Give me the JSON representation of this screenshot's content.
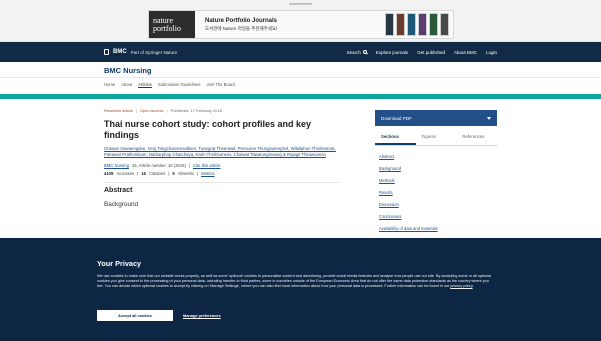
{
  "ad": {
    "label": "Advertisement",
    "logo_line1": "nature",
    "logo_line2": "portfolio",
    "title": "Nature Portfolio Journals",
    "subtitle": "도서관에 Nature 저널을 추천해주세요!"
  },
  "topbar": {
    "brand": "BMC",
    "part": "Part of Springer Nature",
    "search": "Search",
    "nav": [
      "Explore journals",
      "Get published",
      "About BMC",
      "Login"
    ]
  },
  "journal": {
    "title": "BMC Nursing"
  },
  "breadcrumbs": [
    "Home",
    "About",
    "Articles",
    "Submission Guidelines",
    "Join The Board"
  ],
  "article": {
    "type": "Research article",
    "access": "Open Access",
    "published": "Published: 17 February 2016",
    "title": "Thai nurse cohort study: cohort profiles and key findings",
    "authors": "Orawan Sawaengdee, Viroj Tangcharoensathien, Tuangrat Theerawit, Pensuree Thungsureephol, Wilailphon Thiniharnrat, Patrawat Prathumkam, Natharphop Chatchaya, Karin Thinhtumess, Chaiwat Tawatungmaung & Rapigit Thiniwoanon",
    "journal_ref": "BMC Nursing",
    "volume_ref": "15, Article number: 10 (2016)",
    "cite": "Cite this article",
    "accesses_num": "4109",
    "accesses_label": "Accesses",
    "citations_num": "16",
    "citations_label": "Citations",
    "altmetric_num": "5",
    "altmetric_label": "Altmetric",
    "metrics_link": "Metrics",
    "abstract_heading": "Abstract",
    "background_heading": "Background"
  },
  "sidebar": {
    "download": "Download PDF",
    "tabs": [
      "Sections",
      "Figures",
      "References"
    ],
    "sections": [
      "Abstract",
      "Background",
      "Methods",
      "Results",
      "Discussion",
      "Conclusions",
      "Availability of data and materials"
    ]
  },
  "cookie": {
    "title": "Your Privacy",
    "text": "We use cookies to make sure that our website works properly, as well as some 'optional' cookies to personalise content and advertising, provide social media features and analyse how people use our site. By accepting some or all optional cookies you give consent to the processing of your personal data, including transfer to third parties, some in countries outside of the European Economic Area that do not offer the same data protection standards as the country where you live. You can decide which optional cookies to accept by clicking on 'Manage Settings', where you can also find more information about how your personal data is processed. Further information can be found in our",
    "link": "privacy policy",
    "accept": "Accept all cookies",
    "manage": "Manage preferences"
  },
  "colors": {
    "navy": "#112a46",
    "teal": "#0ea39b",
    "link": "#1d4f8c",
    "cookie_bg": "#0d2643"
  }
}
